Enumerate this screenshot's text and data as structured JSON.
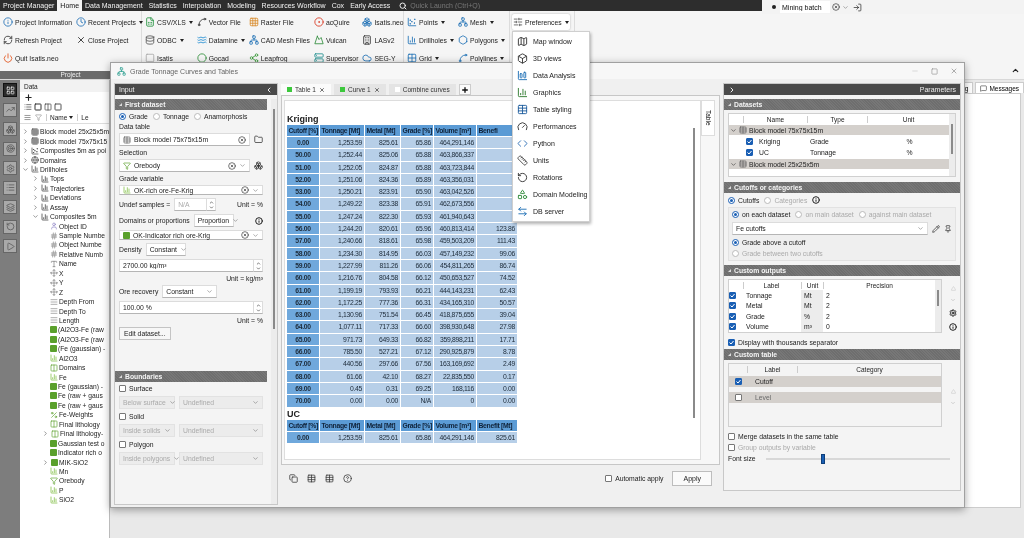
{
  "menu_bar": {
    "tabs": [
      {
        "label": "Project Manager",
        "selected": false
      },
      {
        "label": "Home",
        "selected": true
      },
      {
        "label": "Data Management",
        "selected": false
      },
      {
        "label": "Statistics",
        "selected": false
      },
      {
        "label": "Interpolation",
        "selected": false
      },
      {
        "label": "Modeling",
        "selected": false
      },
      {
        "label": "Resources Workflow",
        "selected": false
      },
      {
        "label": "Cox",
        "selected": false
      },
      {
        "label": "Early Access",
        "selected": false
      }
    ],
    "search": {
      "placeholder": "Quick Launch (Ctrl+Q)"
    },
    "batch": {
      "value": "Mining batch"
    }
  },
  "ribbon": {
    "groups": [
      {
        "label": "Project",
        "columns": [
          [
            {
              "label": "Project Information",
              "menu": false
            },
            {
              "label": "Refresh Project",
              "menu": false
            },
            {
              "label": "Quit Isatis.neo",
              "menu": false
            }
          ],
          [
            {
              "label": "Recent Projects",
              "menu": true
            },
            {
              "label": "Close Project",
              "menu": false
            }
          ]
        ]
      },
      {
        "columns": [
          [
            {
              "label": "CSV/XLS",
              "menu": true
            },
            {
              "label": "ODBC",
              "menu": true
            },
            {
              "label": "Isatis",
              "menu": false
            }
          ],
          [
            {
              "label": "Vector File",
              "menu": false
            },
            {
              "label": "Datamine",
              "menu": true
            },
            {
              "label": "Gocad",
              "menu": false
            }
          ],
          [
            {
              "label": "Raster File",
              "menu": false
            },
            {
              "label": "CAD Mesh Files",
              "menu": false
            },
            {
              "label": "Leapfrog",
              "menu": false
            }
          ],
          [
            {
              "label": "acQuire",
              "menu": false
            },
            {
              "label": "Vulcan",
              "menu": false
            },
            {
              "label": "Supervisor",
              "menu": false
            }
          ],
          [
            {
              "label": "Isatis.neo",
              "menu": false
            },
            {
              "label": "LASv2",
              "menu": false
            },
            {
              "label": "SEG-Y",
              "menu": false
            }
          ]
        ]
      },
      {
        "columns": [
          [
            {
              "label": "Points",
              "menu": true
            },
            {
              "label": "Drillholes",
              "menu": true
            },
            {
              "label": "Grid",
              "menu": true
            }
          ],
          [
            {
              "label": "Mesh",
              "menu": true
            },
            {
              "label": "Polygons",
              "menu": true
            },
            {
              "label": "Polylines",
              "menu": true
            }
          ]
        ]
      }
    ],
    "preferences": {
      "label": "Preferences",
      "expanded": true,
      "items": [
        "Map window",
        "3D views",
        "Data Analysis",
        "Graphics",
        "Table styling",
        "Performances",
        "Python",
        "Units",
        "Rotations",
        "Domain Modeling",
        "DB server"
      ]
    }
  },
  "sidebar": {
    "tools": [
      {
        "selected": true
      },
      {
        "selected": false
      },
      {
        "selected": false
      },
      {
        "selected": false
      },
      {
        "selected": false
      },
      {
        "selected": false
      },
      {
        "selected": false
      },
      {
        "selected": false
      },
      {
        "selected": false
      }
    ]
  },
  "data_panel": {
    "title": "Data",
    "columns": [
      "Name",
      "Le"
    ],
    "tree": [
      {
        "label": "Block model 25x25x5m",
        "kind": "grid",
        "expanded": false
      },
      {
        "label": "Block model 75x75x15",
        "kind": "grid",
        "expanded": false
      },
      {
        "label": "Composites 5m as poi",
        "kind": "points",
        "expanded": false
      },
      {
        "label": "Domains",
        "kind": "globe",
        "expanded": false
      },
      {
        "label": "Drillholes",
        "kind": "drillholes",
        "expanded": true,
        "children": [
          {
            "label": "Tops",
            "kind": "table",
            "expanded": false
          },
          {
            "label": "Trajectories",
            "kind": "table",
            "expanded": false
          },
          {
            "label": "Deviations",
            "kind": "table",
            "expanded": false
          },
          {
            "label": "Assay",
            "kind": "table",
            "expanded": false
          },
          {
            "label": "Composites 5m",
            "kind": "table",
            "expanded": true,
            "children": [
              {
                "label": "Object ID",
                "kind": "id"
              },
              {
                "label": "Sample Numbe",
                "kind": "number"
              },
              {
                "label": "Object Numbe",
                "kind": "number"
              },
              {
                "label": "Relative Numb",
                "kind": "number"
              },
              {
                "label": "Name",
                "kind": "text"
              },
              {
                "label": "X",
                "kind": "coord"
              },
              {
                "label": "Y",
                "kind": "coord"
              },
              {
                "label": "Z",
                "kind": "coord"
              },
              {
                "label": "Depth From",
                "kind": "depth"
              },
              {
                "label": "Depth To",
                "kind": "depth"
              },
              {
                "label": "Length",
                "kind": "depth"
              },
              {
                "label": "(Al2O3-Fe (raw",
                "kind": "variable"
              },
              {
                "label": "(Al2O3-Fe (raw",
                "kind": "variable"
              },
              {
                "label": "(Fe (gaussian) -",
                "kind": "variable"
              },
              {
                "label": "Al2O3",
                "kind": "histogram"
              },
              {
                "label": "Domains",
                "kind": "category"
              },
              {
                "label": "Fe",
                "kind": "histogram"
              },
              {
                "label": "Fe (gaussian) -",
                "kind": "variable"
              },
              {
                "label": "Fe (raw + gaus",
                "kind": "variable"
              },
              {
                "label": "Fe (raw + gaus",
                "kind": "variable"
              },
              {
                "label": "Fe-Weights",
                "kind": "weight"
              },
              {
                "label": "Final lithology",
                "kind": "category"
              },
              {
                "label": "Final lithology-",
                "kind": "category",
                "expanded": false
              },
              {
                "label": "Gaussian test o",
                "kind": "variable"
              },
              {
                "label": "Indicator rich o",
                "kind": "variable"
              },
              {
                "label": "MIK-SiO2",
                "kind": "variable",
                "expanded": false
              },
              {
                "label": "Mn",
                "kind": "histogram"
              },
              {
                "label": "Orebody",
                "kind": "selection"
              },
              {
                "label": "P",
                "kind": "histogram"
              },
              {
                "label": "SiO2",
                "kind": "histogram"
              }
            ]
          }
        ]
      }
    ]
  },
  "workspace_tabs": [
    {
      "label": "g"
    },
    {
      "label": "Messages"
    }
  ],
  "dialog": {
    "title": "Grade Tonnage Curves and Tables",
    "input": {
      "header": "Input",
      "first_dataset": {
        "title": "First dataset",
        "modes": [
          {
            "label": "Grade",
            "selected": true
          },
          {
            "label": "Tonnage",
            "selected": false
          },
          {
            "label": "Anamorphosis",
            "selected": false
          }
        ],
        "data_table": {
          "label": "Data table",
          "value": "Block model 75x75x15m"
        },
        "selection": {
          "label": "Selection",
          "value": "Orebody"
        },
        "grade_variable": {
          "label": "Grade variable",
          "value": "OK-rich ore-Fe-Krig"
        },
        "undef": {
          "label": "Undef samples =",
          "placeholder": "N/A",
          "unit": "Unit = %"
        },
        "domains": {
          "label": "Domains or proportions",
          "option": "Proportion",
          "value": "OK-Indicator rich ore-Krig"
        },
        "density": {
          "label": "Density",
          "option": "Constant",
          "value": "2700.00 kg/m³",
          "unit": "Unit = kg/m³"
        },
        "ore_recovery": {
          "label": "Ore recovery",
          "option": "Constant",
          "value": "100.00 %",
          "unit": "Unit = %"
        },
        "edit_button": "Edit dataset..."
      },
      "boundaries": {
        "title": "Boundaries",
        "items": [
          {
            "label": "Surface",
            "checked": false,
            "option": "Below surface",
            "value": "Undefined"
          },
          {
            "label": "Solid",
            "checked": false,
            "option": "Inside solids",
            "value": "Undefined"
          },
          {
            "label": "Polygon",
            "checked": false,
            "option": "Inside polygons",
            "value": "Undefined"
          }
        ]
      }
    },
    "tabs": [
      {
        "label": "Table 1",
        "selected": true,
        "color": "#3cc83c"
      },
      {
        "label": "Curve 1",
        "selected": false,
        "color": "#3cc83c"
      },
      {
        "label": "Combine curves",
        "selected": false,
        "color": "#ffffff"
      }
    ],
    "side_tab": "Table",
    "tables": [
      {
        "title": "Kriging",
        "columns": [
          "Cutoff [%]",
          "Tonnage [Mt]",
          "Metal [Mt]",
          "Grade [%]",
          "Volume [m³]",
          "Benefi"
        ],
        "rows": [
          [
            "0.00",
            "1,253.59",
            "825.61",
            "65.86",
            "464,291,146"
          ],
          [
            "50.00",
            "1,252.44",
            "825.06",
            "65.88",
            "463,866,337"
          ],
          [
            "51.00",
            "1,252.05",
            "824.87",
            "65.88",
            "463,723,844"
          ],
          [
            "52.00",
            "1,251.06",
            "824.36",
            "65.89",
            "463,356,031"
          ],
          [
            "53.00",
            "1,250.21",
            "823.91",
            "65.90",
            "463,042,526"
          ],
          [
            "54.00",
            "1,249.22",
            "823.38",
            "65.91",
            "462,673,556"
          ],
          [
            "55.00",
            "1,247.24",
            "822.30",
            "65.93",
            "461,940,643"
          ],
          [
            "56.00",
            "1,244.20",
            "820.61",
            "65.96",
            "460,813,414",
            "123.86"
          ],
          [
            "57.00",
            "1,240.66",
            "818.61",
            "65.98",
            "459,503,209",
            "111.43"
          ],
          [
            "58.00",
            "1,234.30",
            "814.95",
            "66.03",
            "457,149,232",
            "99.06"
          ],
          [
            "59.00",
            "1,227.99",
            "811.26",
            "66.06",
            "454,811,265",
            "86.74"
          ],
          [
            "60.00",
            "1,216.76",
            "804.58",
            "66.12",
            "450,653,527",
            "74.52"
          ],
          [
            "61.00",
            "1,199.19",
            "793.93",
            "66.21",
            "444,143,231",
            "62.43"
          ],
          [
            "62.00",
            "1,172.25",
            "777.36",
            "66.31",
            "434,165,310",
            "50.57"
          ],
          [
            "63.00",
            "1,130.96",
            "751.54",
            "66.45",
            "418,875,655",
            "39.04"
          ],
          [
            "64.00",
            "1,077.11",
            "717.33",
            "66.60",
            "398,930,648",
            "27.98"
          ],
          [
            "65.00",
            "971.73",
            "649.33",
            "66.82",
            "359,898,211",
            "17.71"
          ],
          [
            "66.00",
            "785.50",
            "527.21",
            "67.12",
            "290,925,879",
            "8.78"
          ],
          [
            "67.00",
            "440.56",
            "297.66",
            "67.56",
            "163,169,692",
            "2.49"
          ],
          [
            "68.00",
            "61.66",
            "42.10",
            "68.27",
            "22,835,550",
            "0.17"
          ],
          [
            "69.00",
            "0.45",
            "0.31",
            "69.25",
            "168,116",
            "0.00"
          ],
          [
            "70.00",
            "0.00",
            "0.00",
            "N/A",
            "0",
            "0.00"
          ]
        ]
      },
      {
        "title": "UC",
        "columns": [
          "Cutoff [%]",
          "Tonnage [Mt]",
          "Metal [Mt]",
          "Grade [%]",
          "Volume [m³]",
          "Benefit [Mt]"
        ],
        "rows": [
          [
            "0.00",
            "1,253.59",
            "825.61",
            "65.86",
            "464,291,146",
            "825.61"
          ]
        ]
      }
    ],
    "automatic_apply": {
      "label": "Automatic apply",
      "checked": false
    },
    "apply_button": "Apply",
    "parameters": {
      "header": "Parameters",
      "datasets": {
        "title": "Datasets",
        "columns": [
          "Name",
          "Type",
          "Unit"
        ],
        "groups": [
          {
            "name": "Block model 75x75x15m",
            "expanded": true,
            "items": [
              {
                "name": "Kriging",
                "type": "Grade",
                "unit": "%",
                "checked": true
              },
              {
                "name": "UC",
                "type": "Tonnage",
                "unit": "%",
                "checked": true
              }
            ]
          },
          {
            "name": "Block model 25x25x5m",
            "expanded": true
          }
        ]
      },
      "cutoffs": {
        "title": "Cutoffs or categories",
        "modes": [
          {
            "label": "Cutoffs",
            "selected": true
          },
          {
            "label": "Categories",
            "selected": false
          }
        ],
        "scopes": [
          {
            "label": "on each dataset",
            "selected": true
          },
          {
            "label": "on main dataset",
            "selected": false
          },
          {
            "label": "against main dataset",
            "selected": false
          }
        ],
        "cutoff_set": "Fe cutoffs",
        "grade_modes": [
          {
            "label": "Grade above a cutoff",
            "selected": true
          },
          {
            "label": "Grade between two cutoffs",
            "selected": false
          }
        ]
      },
      "custom_outputs": {
        "title": "Custom outputs",
        "columns": [
          "Label",
          "Unit",
          "Precision"
        ],
        "rows": [
          {
            "label": "Tonnage",
            "unit": "Mt",
            "precision": "2",
            "checked": true
          },
          {
            "label": "Metal",
            "unit": "Mt",
            "precision": "2",
            "checked": true
          },
          {
            "label": "Grade",
            "unit": "%",
            "precision": "2",
            "checked": true
          },
          {
            "label": "Volume",
            "unit": "m³",
            "precision": "0",
            "checked": true
          }
        ],
        "thousands": {
          "label": "Display with thousands separator",
          "checked": true
        }
      },
      "custom_table": {
        "title": "Custom table",
        "columns": [
          "Label",
          "Category"
        ],
        "rows": [
          {
            "label": "Cutoff",
            "checked": true
          },
          {
            "label": "Level",
            "checked": false
          }
        ]
      },
      "merge": {
        "label": "Merge datasets in the same table",
        "checked": false
      },
      "group_outputs": {
        "label": "Group outputs by variable",
        "checked": false
      },
      "font_size": {
        "label": "Font size",
        "level": 0.31
      }
    }
  }
}
